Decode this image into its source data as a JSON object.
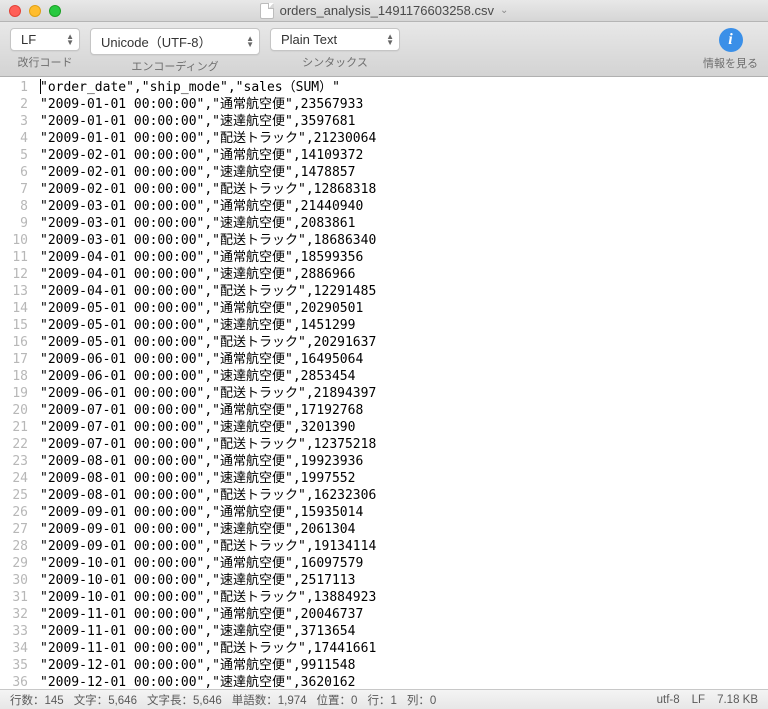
{
  "window": {
    "filename": "orders_analysis_1491176603258.csv"
  },
  "toolbar": {
    "lineEnding": {
      "value": "LF",
      "label": "改行コード"
    },
    "encoding": {
      "value": "Unicode（UTF-8）",
      "label": "エンコーディング"
    },
    "syntax": {
      "value": "Plain Text",
      "label": "シンタックス"
    },
    "info": {
      "label": "情報を見る"
    }
  },
  "code": {
    "lines": [
      "\"order_date\",\"ship_mode\",\"sales（SUM）\"",
      "\"2009-01-01 00:00:00\",\"通常航空便\",23567933",
      "\"2009-01-01 00:00:00\",\"速達航空便\",3597681",
      "\"2009-01-01 00:00:00\",\"配送トラック\",21230064",
      "\"2009-02-01 00:00:00\",\"通常航空便\",14109372",
      "\"2009-02-01 00:00:00\",\"速達航空便\",1478857",
      "\"2009-02-01 00:00:00\",\"配送トラック\",12868318",
      "\"2009-03-01 00:00:00\",\"通常航空便\",21440940",
      "\"2009-03-01 00:00:00\",\"速達航空便\",2083861",
      "\"2009-03-01 00:00:00\",\"配送トラック\",18686340",
      "\"2009-04-01 00:00:00\",\"通常航空便\",18599356",
      "\"2009-04-01 00:00:00\",\"速達航空便\",2886966",
      "\"2009-04-01 00:00:00\",\"配送トラック\",12291485",
      "\"2009-05-01 00:00:00\",\"通常航空便\",20290501",
      "\"2009-05-01 00:00:00\",\"速達航空便\",1451299",
      "\"2009-05-01 00:00:00\",\"配送トラック\",20291637",
      "\"2009-06-01 00:00:00\",\"通常航空便\",16495064",
      "\"2009-06-01 00:00:00\",\"速達航空便\",2853454",
      "\"2009-06-01 00:00:00\",\"配送トラック\",21894397",
      "\"2009-07-01 00:00:00\",\"通常航空便\",17192768",
      "\"2009-07-01 00:00:00\",\"速達航空便\",3201390",
      "\"2009-07-01 00:00:00\",\"配送トラック\",12375218",
      "\"2009-08-01 00:00:00\",\"通常航空便\",19923936",
      "\"2009-08-01 00:00:00\",\"速達航空便\",1997552",
      "\"2009-08-01 00:00:00\",\"配送トラック\",16232306",
      "\"2009-09-01 00:00:00\",\"通常航空便\",15935014",
      "\"2009-09-01 00:00:00\",\"速達航空便\",2061304",
      "\"2009-09-01 00:00:00\",\"配送トラック\",19134114",
      "\"2009-10-01 00:00:00\",\"通常航空便\",16097579",
      "\"2009-10-01 00:00:00\",\"速達航空便\",2517113",
      "\"2009-10-01 00:00:00\",\"配送トラック\",13884923",
      "\"2009-11-01 00:00:00\",\"通常航空便\",20046737",
      "\"2009-11-01 00:00:00\",\"速達航空便\",3713654",
      "\"2009-11-01 00:00:00\",\"配送トラック\",17441661",
      "\"2009-12-01 00:00:00\",\"通常航空便\",9911548",
      "\"2009-12-01 00:00:00\",\"速達航空便\",3620162"
    ]
  },
  "status": {
    "linesLabel": "行数：",
    "lines": "145",
    "charsLabel": "文字：",
    "chars": "5,646",
    "lengthLabel": "文字長：",
    "length": "5,646",
    "wordsLabel": "単語数：",
    "words": "1,974",
    "posLabel": "位置：",
    "pos": "0",
    "lineLabel": "行：",
    "line": "1",
    "colLabel": "列：",
    "col": "0",
    "encoding": "utf-8",
    "lineEnding": "LF",
    "size": "7.18 KB"
  }
}
